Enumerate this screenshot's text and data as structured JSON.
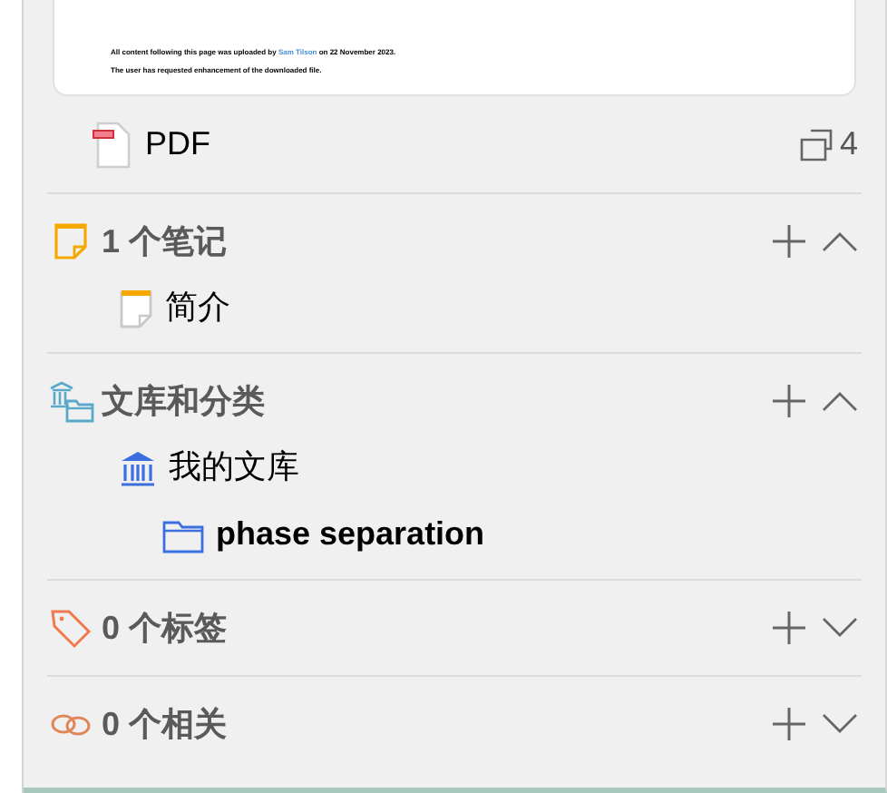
{
  "preview": {
    "uploaded_before": "All content following this page was uploaded by ",
    "uploaded_link": "Sam Tilson",
    "uploaded_after": " on 22 November 2023.",
    "notice": "The user has requested enhancement of the downloaded file."
  },
  "attachment": {
    "label": "PDF",
    "count": "4"
  },
  "sections": [
    {
      "kind": "notes",
      "title": "1 个笔记",
      "expanded": true,
      "items": [
        {
          "kind": "note",
          "label": "简介",
          "selected": false
        }
      ]
    },
    {
      "kind": "collections",
      "title": "文库和分类",
      "expanded": true,
      "items": [
        {
          "kind": "library",
          "label": "我的文库",
          "selected": false,
          "children": [
            {
              "kind": "folder",
              "label": "phase separation",
              "selected": true
            }
          ]
        }
      ]
    },
    {
      "kind": "tags",
      "title": "0 个标签",
      "expanded": false
    },
    {
      "kind": "related",
      "title": "0 个相关",
      "expanded": false
    }
  ]
}
